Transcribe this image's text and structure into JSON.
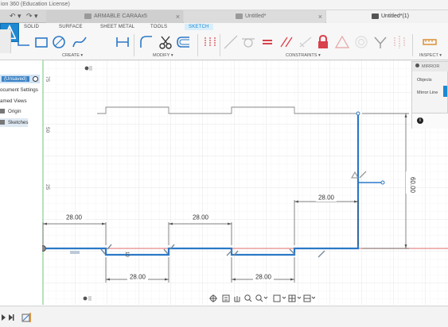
{
  "window": {
    "title": "ion 360 (Education License)"
  },
  "tabs": [
    {
      "label": "ARMABLE CARAAx5",
      "close": "×"
    },
    {
      "label": "Untitled*",
      "close": "×"
    },
    {
      "label": "Untitled*(1)",
      "close": ""
    }
  ],
  "quick_access": {
    "undo": "↶ ▾",
    "redo": "↷ ▾"
  },
  "toolbar": {
    "workspace_tabs": [
      "SOLID",
      "SURFACE",
      "SHEET METAL",
      "TOOLS",
      "SKETCH"
    ],
    "groups": {
      "create": "CREATE ▾",
      "modify": "MODIFY ▾",
      "constraints": "CONSTRAINTS ▾",
      "inspect": "INSPECT ▾"
    }
  },
  "browser": {
    "root": "(Unsaved)",
    "items": [
      "ocument Settings",
      "amed Views",
      "Origin",
      "Sketches"
    ]
  },
  "mirror_dialog": {
    "title": "MIRROR",
    "objects_label": "Objects",
    "mirror_line_label": "Mirror Line",
    "info_icon": "i"
  },
  "sketch": {
    "ruler_labels": [
      "75",
      "50",
      "25"
    ],
    "dimensions": [
      "28.00",
      "28.00",
      "28.00",
      "28.00",
      "28.00"
    ],
    "vertical_dimension": "60.00",
    "inline_dimension": "10"
  },
  "colors": {
    "sketch_line": "#2b78c7",
    "accent": "#1e88d2",
    "lock_icon": "#d9414b",
    "origin_axis": "#e06b6b",
    "y_axis": "#5ec26a"
  }
}
